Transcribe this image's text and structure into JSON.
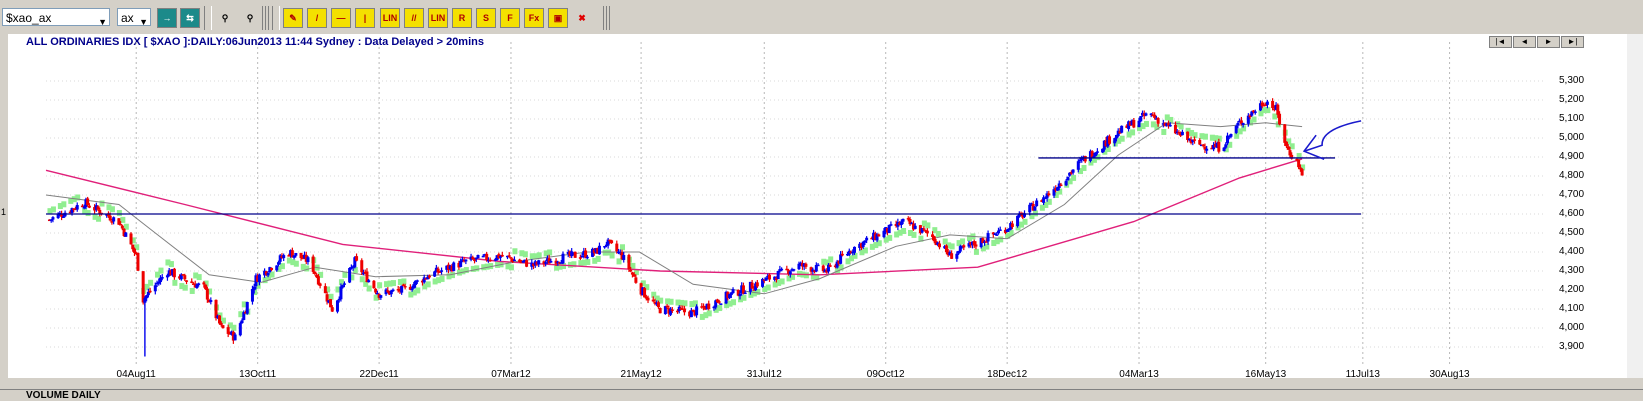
{
  "toolbar": {
    "symbol_value": "$xao_ax",
    "exchange_value": "ax",
    "buttons": [
      {
        "name": "go-button",
        "label": "→",
        "style": "teal"
      },
      {
        "name": "refresh-button",
        "label": "⇆",
        "style": "teal"
      },
      {
        "name": "binoculars-icon",
        "label": "⚲",
        "style": "grey"
      },
      {
        "name": "binoculars-disabled-icon",
        "label": "⚲",
        "style": "grey"
      },
      {
        "name": "draw-pencil-tool",
        "label": "✎",
        "style": "yellow"
      },
      {
        "name": "trendline-tool",
        "label": "/",
        "style": "yellow"
      },
      {
        "name": "horizontal-line-tool",
        "label": "—",
        "style": "yellow"
      },
      {
        "name": "vertical-line-tool",
        "label": "|",
        "style": "yellow"
      },
      {
        "name": "lin-tool",
        "label": "LIN",
        "style": "yellow"
      },
      {
        "name": "parallel-lines-tool",
        "label": "//",
        "style": "yellow"
      },
      {
        "name": "lin-channel-tool",
        "label": "LIN",
        "style": "yellow"
      },
      {
        "name": "retracement-tool",
        "label": "R",
        "style": "yellow"
      },
      {
        "name": "speed-lines-tool",
        "label": "S",
        "style": "yellow"
      },
      {
        "name": "fibonacci-tool",
        "label": "F",
        "style": "yellow"
      },
      {
        "name": "fibonacci-ext-tool",
        "label": "Fx",
        "style": "yellow"
      },
      {
        "name": "text-tool",
        "label": "▣",
        "style": "yellow"
      },
      {
        "name": "delete-tool",
        "label": "✖",
        "style": "grey"
      }
    ]
  },
  "chart_title": "ALL ORDINARIES IDX [ $XAO ]:DAILY:06Jun2013 11:44 Sydney : Data Delayed > 20mins",
  "left_marker": "1",
  "nav_buttons": [
    "|◄",
    "◄",
    "►",
    "►|"
  ],
  "volume_label": "VOLUME DAILY",
  "colors": {
    "up": "#0000ee",
    "down": "#ee0000",
    "band": "#90ee90",
    "ma_long": "#e0207a",
    "ma_short": "#808080",
    "hline": "#00008b",
    "annotation": "#1a1acc"
  },
  "chart_data": {
    "type": "line",
    "title": "ALL ORDINARIES IDX [ $XAO ]:DAILY:06Jun2013 11:44 Sydney : Data Delayed > 20mins",
    "x_ticks": [
      "04Aug11",
      "13Oct11",
      "22Dec11",
      "07Mar12",
      "21May12",
      "31Jul12",
      "09Oct12",
      "18Dec12",
      "04Mar13",
      "16May13",
      "11Jul13",
      "30Aug13"
    ],
    "y_ticks": [
      "5,300",
      "5,200",
      "5,100",
      "5,000",
      "4,900",
      "4,800",
      "4,700",
      "4,600",
      "4,500",
      "4,400",
      "4,300",
      "4,200",
      "4,100",
      "4,000",
      "3,900"
    ],
    "ylim": [
      3800,
      5400
    ],
    "grid": true,
    "x_start": "2011-06-13",
    "x_end": "2013-10-24",
    "price_path": [
      [
        "2011-06-15",
        4570
      ],
      [
        "2011-07-05",
        4660
      ],
      [
        "2011-07-25",
        4560
      ],
      [
        "2011-08-04",
        4380
      ],
      [
        "2011-08-08",
        4150
      ],
      [
        "2011-08-22",
        4300
      ],
      [
        "2011-09-12",
        4210
      ],
      [
        "2011-09-22",
        4000
      ],
      [
        "2011-09-30",
        3950
      ],
      [
        "2011-10-12",
        4260
      ],
      [
        "2011-10-31",
        4400
      ],
      [
        "2011-11-12",
        4350
      ],
      [
        "2011-11-25",
        4100
      ],
      [
        "2011-12-08",
        4350
      ],
      [
        "2011-12-22",
        4180
      ],
      [
        "2012-01-05",
        4200
      ],
      [
        "2012-01-20",
        4280
      ],
      [
        "2012-02-10",
        4350
      ],
      [
        "2012-03-01",
        4380
      ],
      [
        "2012-03-20",
        4330
      ],
      [
        "2012-04-05",
        4370
      ],
      [
        "2012-04-25",
        4400
      ],
      [
        "2012-05-01",
        4450
      ],
      [
        "2012-05-10",
        4380
      ],
      [
        "2012-05-21",
        4200
      ],
      [
        "2012-05-31",
        4100
      ],
      [
        "2012-06-20",
        4080
      ],
      [
        "2012-07-05",
        4150
      ],
      [
        "2012-07-31",
        4250
      ],
      [
        "2012-08-20",
        4330
      ],
      [
        "2012-09-05",
        4300
      ],
      [
        "2012-09-20",
        4420
      ],
      [
        "2012-10-09",
        4510
      ],
      [
        "2012-10-20",
        4560
      ],
      [
        "2012-11-05",
        4480
      ],
      [
        "2012-11-15",
        4380
      ],
      [
        "2012-12-01",
        4450
      ],
      [
        "2012-12-18",
        4530
      ],
      [
        "2013-01-10",
        4700
      ],
      [
        "2013-01-30",
        4880
      ],
      [
        "2013-02-20",
        5030
      ],
      [
        "2013-03-10",
        5130
      ],
      [
        "2013-03-22",
        5050
      ],
      [
        "2013-04-05",
        4970
      ],
      [
        "2013-04-20",
        4950
      ],
      [
        "2013-05-01",
        5080
      ],
      [
        "2013-05-10",
        5150
      ],
      [
        "2013-05-16",
        5200
      ],
      [
        "2013-05-22",
        5150
      ],
      [
        "2013-05-28",
        4950
      ],
      [
        "2013-06-04",
        4860
      ],
      [
        "2013-06-06",
        4800
      ]
    ],
    "series": [
      {
        "name": "",
        "role": "ma_long",
        "points": [
          [
            "2011-06-13",
            4830
          ],
          [
            "2011-09-01",
            4650
          ],
          [
            "2011-12-01",
            4440
          ],
          [
            "2012-03-01",
            4350
          ],
          [
            "2012-06-01",
            4300
          ],
          [
            "2012-09-01",
            4280
          ],
          [
            "2012-12-01",
            4320
          ],
          [
            "2013-03-01",
            4560
          ],
          [
            "2013-05-01",
            4790
          ],
          [
            "2013-06-06",
            4890
          ]
        ]
      },
      {
        "name": "",
        "role": "ma_short",
        "points": [
          [
            "2011-06-13",
            4700
          ],
          [
            "2011-07-25",
            4650
          ],
          [
            "2011-08-15",
            4500
          ],
          [
            "2011-09-15",
            4280
          ],
          [
            "2011-10-15",
            4240
          ],
          [
            "2011-11-15",
            4320
          ],
          [
            "2011-12-20",
            4270
          ],
          [
            "2012-02-01",
            4280
          ],
          [
            "2012-03-10",
            4350
          ],
          [
            "2012-04-20",
            4400
          ],
          [
            "2012-05-20",
            4400
          ],
          [
            "2012-06-20",
            4230
          ],
          [
            "2012-07-31",
            4180
          ],
          [
            "2012-09-01",
            4260
          ],
          [
            "2012-10-15",
            4430
          ],
          [
            "2012-11-15",
            4490
          ],
          [
            "2012-12-18",
            4470
          ],
          [
            "2013-01-20",
            4650
          ],
          [
            "2013-02-20",
            4910
          ],
          [
            "2013-03-20",
            5080
          ],
          [
            "2013-04-20",
            5060
          ],
          [
            "2013-05-16",
            5080
          ],
          [
            "2013-06-06",
            5060
          ]
        ]
      }
    ],
    "horizontal_lines": [
      {
        "value": 4600,
        "from": "2011-06-13",
        "to": "2013-07-10"
      },
      {
        "value": 4895,
        "from": "2013-01-05",
        "to": "2013-06-25"
      }
    ],
    "annotation_arrow": {
      "from": [
        "2013-07-10",
        5090
      ],
      "to": [
        "2013-06-06",
        4920
      ]
    }
  }
}
